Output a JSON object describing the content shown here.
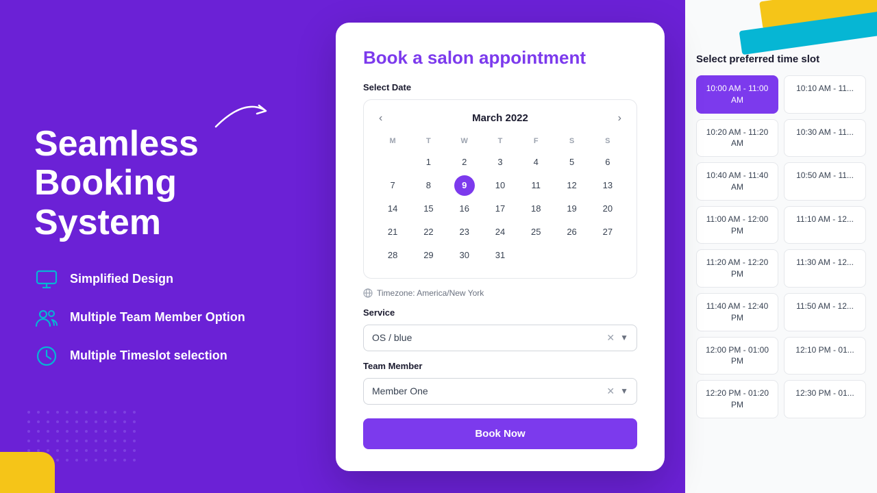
{
  "left": {
    "title": "Seamless Booking System",
    "features": [
      {
        "id": "simplified-design",
        "label": "Simplified Design",
        "icon": "monitor"
      },
      {
        "id": "multiple-team",
        "label": "Multiple Team Member Option",
        "icon": "users"
      },
      {
        "id": "multiple-timeslot",
        "label": "Multiple Timeslot selection",
        "icon": "clock"
      }
    ]
  },
  "modal": {
    "title": "Book a salon appointment",
    "select_date_label": "Select Date",
    "calendar": {
      "month": "March 2022",
      "day_headers": [
        "M",
        "T",
        "W",
        "T",
        "F",
        "S",
        "S"
      ],
      "selected_day": 9,
      "weeks": [
        [
          null,
          null,
          null,
          null,
          null,
          null,
          null
        ],
        [
          null,
          1,
          2,
          3,
          4,
          5,
          6
        ],
        [
          7,
          8,
          9,
          10,
          11,
          12,
          13
        ],
        [
          14,
          15,
          16,
          17,
          18,
          19,
          20
        ],
        [
          21,
          22,
          23,
          24,
          25,
          26,
          27
        ],
        [
          28,
          29,
          30,
          31,
          null,
          null,
          null
        ]
      ]
    },
    "timezone_label": "Timezone: America/New York",
    "service_label": "Service",
    "service_value": "OS / blue",
    "team_member_label": "Team Member",
    "team_member_value": "Member One",
    "book_button": "Book Now"
  },
  "right": {
    "title": "Select preferred time slot",
    "slots": [
      {
        "id": "slot-1",
        "label": "10:00 AM - 11:00 AM",
        "active": true
      },
      {
        "id": "slot-2",
        "label": "10:10 AM - 11..."
      },
      {
        "id": "slot-3",
        "label": "10:20 AM - 11:20 AM"
      },
      {
        "id": "slot-4",
        "label": "10:30 AM - 11..."
      },
      {
        "id": "slot-5",
        "label": "10:40 AM - 11:40 AM"
      },
      {
        "id": "slot-6",
        "label": "10:50 AM - 11..."
      },
      {
        "id": "slot-7",
        "label": "11:00 AM - 12:00 PM"
      },
      {
        "id": "slot-8",
        "label": "11:10 AM - 12..."
      },
      {
        "id": "slot-9",
        "label": "11:20 AM - 12:20 PM"
      },
      {
        "id": "slot-10",
        "label": "11:30 AM - 12..."
      },
      {
        "id": "slot-11",
        "label": "11:40 AM - 12:40 PM"
      },
      {
        "id": "slot-12",
        "label": "11:50 AM - 12..."
      },
      {
        "id": "slot-13",
        "label": "12:00 PM - 01:00 PM"
      },
      {
        "id": "slot-14",
        "label": "12:10 PM - 01..."
      },
      {
        "id": "slot-15",
        "label": "12:20 PM - 01:20 PM"
      },
      {
        "id": "slot-16",
        "label": "12:30 PM - 01..."
      }
    ]
  }
}
